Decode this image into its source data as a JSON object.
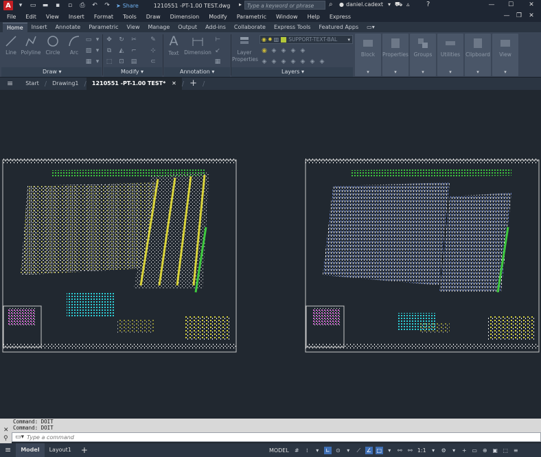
{
  "titlebar": {
    "logo": "A",
    "share": "Share",
    "document_title": "1210551 -PT-1.00 TEST.dwg",
    "search_placeholder": "Type a keyword or phrase",
    "username": "daniel.cadext"
  },
  "menubar": {
    "items": [
      "File",
      "Edit",
      "View",
      "Insert",
      "Format",
      "Tools",
      "Draw",
      "Dimension",
      "Modify",
      "Parametric",
      "Window",
      "Help",
      "Express"
    ]
  },
  "ribbon_tabs": {
    "items": [
      "Home",
      "Insert",
      "Annotate",
      "Parametric",
      "View",
      "Manage",
      "Output",
      "Add-ins",
      "Collaborate",
      "Express Tools",
      "Featured Apps"
    ],
    "active": "Home"
  },
  "ribbon": {
    "draw": {
      "title": "Draw",
      "line": "Line",
      "polyline": "Polyline",
      "circle": "Circle",
      "arc": "Arc"
    },
    "modify": {
      "title": "Modify"
    },
    "annotation": {
      "title": "Annotation",
      "text": "Text",
      "dimension": "Dimension"
    },
    "layers": {
      "title": "Layers",
      "layer_properties_1": "Layer",
      "layer_properties_2": "Properties",
      "current_layer": "SUPPORT-TEXT-BAL"
    },
    "block": "Block",
    "properties": "Properties",
    "groups": "Groups",
    "utilities": "Utilities",
    "clipboard": "Clipboard",
    "view": "View"
  },
  "file_tabs": {
    "items": [
      "Start",
      "Drawing1",
      "1210551 -PT-1.00 TEST*"
    ],
    "active": "1210551 -PT-1.00 TEST*"
  },
  "command": {
    "history": [
      "Command: DOIT",
      "Command: DOIT"
    ],
    "placeholder": "Type a command"
  },
  "statusbar": {
    "tabs": [
      "Model",
      "Layout1"
    ],
    "active": "Model",
    "model_label": "MODEL",
    "scale": "1:1"
  },
  "colors": {
    "canvas": "#212830",
    "ribbon": "#3b4657",
    "accent_blue": "#3f6fb4",
    "logo_red": "#c41f25"
  }
}
